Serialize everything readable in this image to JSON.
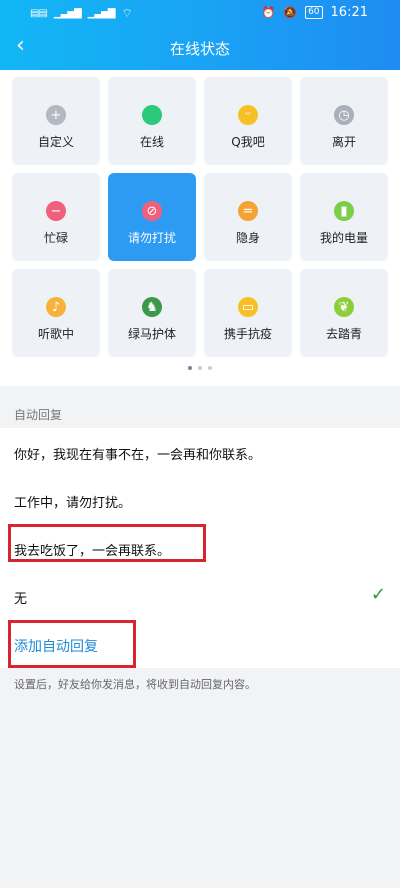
{
  "status_bar": {
    "time": "16:21",
    "battery": "60"
  },
  "nav": {
    "title": "在线状态"
  },
  "statuses": [
    {
      "label": "自定义",
      "icon": "plus-icon",
      "color": "#b4b8c0",
      "glyph": "+"
    },
    {
      "label": "在线",
      "icon": "online-dot-icon",
      "color": "#2bc97a",
      "glyph": ""
    },
    {
      "label": "Q我吧",
      "icon": "smile-face-icon",
      "color": "#f6c026",
      "glyph": "ᵕ"
    },
    {
      "label": "离开",
      "icon": "clock-icon",
      "color": "#aab0ba",
      "glyph": "◷"
    },
    {
      "label": "忙碌",
      "icon": "busy-minus-icon",
      "color": "#f0607a",
      "glyph": "−"
    },
    {
      "label": "请勿打扰",
      "icon": "do-not-disturb-icon",
      "color": "#f0607a",
      "glyph": "⊘"
    },
    {
      "label": "隐身",
      "icon": "invisible-icon",
      "color": "#f6a336",
      "glyph": "="
    },
    {
      "label": "我的电量",
      "icon": "battery-icon",
      "color": "#7ccd4a",
      "glyph": "▮"
    },
    {
      "label": "听歌中",
      "icon": "music-headphones-icon",
      "color": "#f6b23a",
      "glyph": "♪"
    },
    {
      "label": "绿马护体",
      "icon": "green-horse-icon",
      "color": "#3a9a4a",
      "glyph": "♞"
    },
    {
      "label": "携手抗疫",
      "icon": "mask-face-icon",
      "color": "#f6c026",
      "glyph": "▭"
    },
    {
      "label": "去踏青",
      "icon": "leaf-icon",
      "color": "#8ccf3a",
      "glyph": "❦"
    }
  ],
  "active_index": 5,
  "auto_reply": {
    "section_title": "自动回复",
    "items": [
      "你好，我现在有事不在，一会再和你联系。",
      "工作中，请勿打扰。",
      "我去吃饭了，一会再联系。",
      "无"
    ],
    "selected_index": 3,
    "add_label": "添加自动回复",
    "hint": "设置后，好友给你发消息，将收到自动回复内容。"
  }
}
